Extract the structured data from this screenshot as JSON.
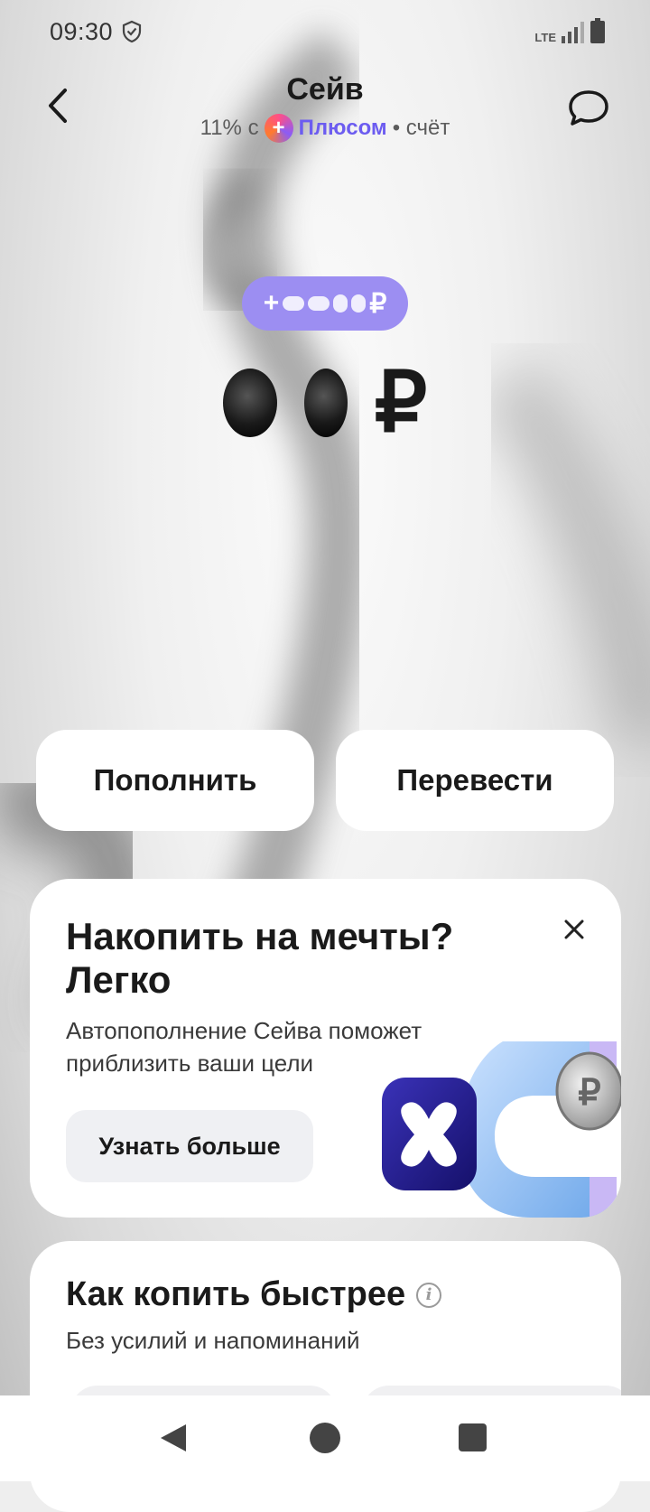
{
  "status_bar": {
    "time": "09:30",
    "network": "LTE"
  },
  "header": {
    "title": "Сейв",
    "subtitle_rate": "11% с",
    "subtitle_brand": "Плюсом",
    "subtitle_suffix": "• счёт",
    "back_icon": "chevron-left-icon",
    "chat_icon": "chat-bubble-icon"
  },
  "balance": {
    "bonus_prefix": "+",
    "bonus_currency": "₽",
    "currency": "₽"
  },
  "actions": {
    "top_up_label": "Пополнить",
    "transfer_label": "Перевести"
  },
  "promo": {
    "title": "Накопить на мечты? Легко",
    "text": "Автопополнение Сейва поможет приблизить ваши цели",
    "button_label": "Узнать больше"
  },
  "tips": {
    "title": "Как копить быстрее",
    "subtitle": "Без усилий и напоминаний"
  },
  "colors": {
    "accent_purple": "#9c8ef2",
    "plus_brand": "#6c5cf0",
    "card_bg": "#ffffff"
  }
}
